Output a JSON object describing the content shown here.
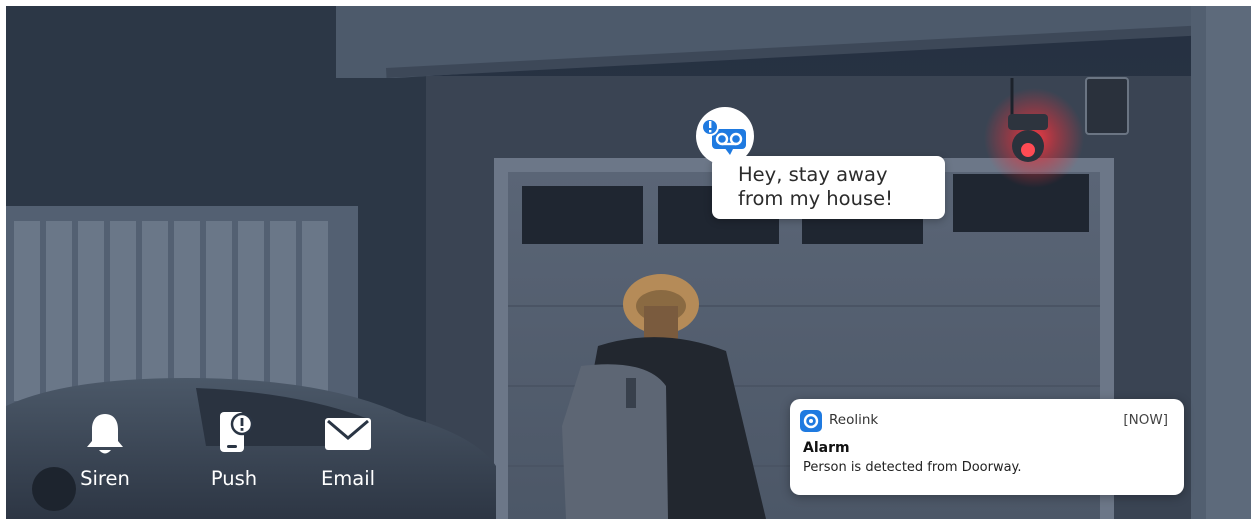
{
  "speech_bubble": {
    "line1": "Hey, stay away",
    "line2": "from my house!",
    "icon": "voicemail-alert-icon",
    "accent_color": "#1f7ae0"
  },
  "alert_methods": [
    {
      "label": "Siren",
      "icon": "bell-icon"
    },
    {
      "label": "Push",
      "icon": "phone-alert-icon"
    },
    {
      "label": "Email",
      "icon": "envelope-icon"
    }
  ],
  "notification": {
    "app_name": "Reolink",
    "time": "[NOW]",
    "title": "Alarm",
    "body": "Person is detected from Doorway.",
    "app_icon": "reolink-app-icon",
    "app_color": "#1f7ae0"
  },
  "colors": {
    "night_wall": "#3b4656",
    "garage_door": "#5b6778",
    "siren_glow": "#e0313a"
  }
}
